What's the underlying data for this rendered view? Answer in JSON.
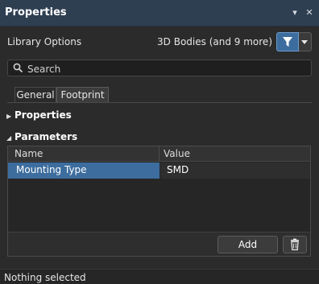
{
  "panel": {
    "title": "Properties",
    "pin_icon": "dropdown-arrow-icon",
    "close_icon": "close-icon"
  },
  "library": {
    "label": "Library Options",
    "filter_summary": "3D Bodies (and 9 more)",
    "filter_icon": "filter-icon"
  },
  "search": {
    "placeholder": "Search",
    "value": ""
  },
  "tabs": [
    {
      "label": "General",
      "active": false
    },
    {
      "label": "Footprint",
      "active": true
    }
  ],
  "sections": {
    "properties": {
      "label": "Properties",
      "expanded": false
    },
    "parameters": {
      "label": "Parameters",
      "expanded": true
    }
  },
  "parameters_table": {
    "columns": [
      "Name",
      "Value"
    ],
    "rows": [
      {
        "name": "Mounting Type",
        "value": "SMD",
        "selected": true
      }
    ],
    "add_label": "Add",
    "delete_icon": "trash-icon"
  },
  "status": {
    "text": "Nothing selected"
  },
  "colors": {
    "accent": "#3d6d9e",
    "titlebar": "#2f3f52",
    "background": "#2b2b2b"
  }
}
